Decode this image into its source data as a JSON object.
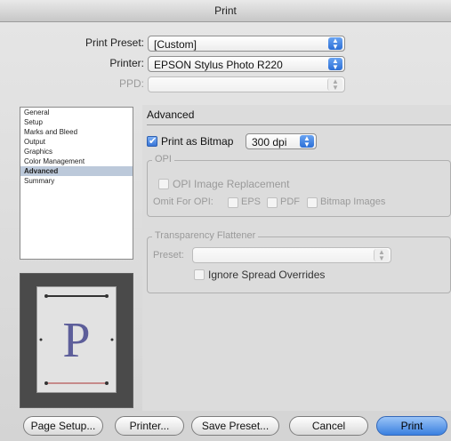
{
  "window": {
    "title": "Print"
  },
  "top": {
    "preset_label": "Print Preset:",
    "preset_value": "[Custom]",
    "printer_label": "Printer:",
    "printer_value": "EPSON Stylus Photo R220",
    "ppd_label": "PPD:",
    "ppd_value": ""
  },
  "sidebar": {
    "items": [
      {
        "label": "General"
      },
      {
        "label": "Setup"
      },
      {
        "label": "Marks and Bleed"
      },
      {
        "label": "Output"
      },
      {
        "label": "Graphics"
      },
      {
        "label": "Color Management"
      },
      {
        "label": "Advanced",
        "selected": true
      },
      {
        "label": "Summary"
      }
    ]
  },
  "preview": {
    "letter": "P"
  },
  "advanced": {
    "title": "Advanced",
    "print_as_bitmap_label": "Print as Bitmap",
    "print_as_bitmap_checked": true,
    "dpi_value": "300 dpi",
    "opi": {
      "group_label": "OPI",
      "replacement_label": "OPI Image Replacement",
      "omit_label": "Omit For OPI:",
      "eps_label": "EPS",
      "pdf_label": "PDF",
      "bitmap_label": "Bitmap Images"
    },
    "flattener": {
      "group_label": "Transparency Flattener",
      "preset_label": "Preset:",
      "preset_value": "",
      "ignore_label": "Ignore Spread Overrides"
    }
  },
  "buttons": {
    "page_setup": "Page Setup...",
    "printer": "Printer...",
    "save_preset": "Save Preset...",
    "cancel": "Cancel",
    "print": "Print"
  }
}
